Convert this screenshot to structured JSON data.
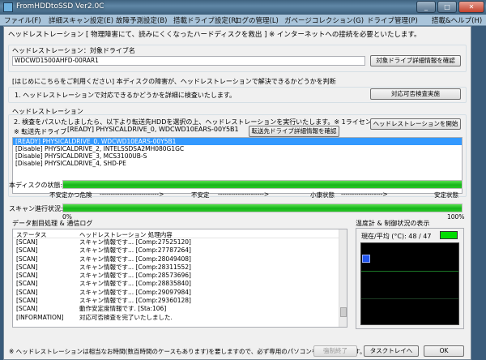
{
  "window": {
    "title": "FromHDDtoSSD Ver2.0C",
    "min": "_",
    "max": "□",
    "close": "✕"
  },
  "menu": [
    "ファイル(F)",
    "詳細スキャン設定(E)",
    "故障予測設定(B)",
    "搭載ドライブ設定(R)",
    "ログの管理(L)",
    "ガベージコレクション(G)",
    "ドライブ管理(P)",
    "搭載&ヘルプ(H)"
  ],
  "dialog": {
    "title": "ヘッドレストレーション [ 物理障害にて、読みにくくなったハードディスクを救出 ] ※ インターネットへの接続を必要といたします。",
    "target_label": "ヘッドレストレーション：対象ドライブ名",
    "target_value": "WDCWD1500AHFD-00RAR1",
    "target_btn": "対象ドライブ詳細情報を確認",
    "intro_text": "[はじめにこちらをご利用ください] 本ディスクの障害が、ヘッドレストレーションで解決できるかどうかを判断",
    "step1_text": "1. ヘッドレストレーションで対応できるかどうかを詳細に検査いたします。",
    "step1_btn": "対応可否検査実施",
    "section_label": "ヘッドレストレーション",
    "step2_text": "2. 検査をパスいたしましたら、以下より転送先HDDを選択の上、ヘッドレストレーションを実行いたします。※ 1ライセンスを消費いたします。",
    "start_btn": "ヘッドレストレーションを開始",
    "dest_label": "※ 転送先ドライブ",
    "dest_value": "[READY] PHYSICALDRIVE_0, WDCWD10EARS-00Y5B1",
    "dest_btn": "転送先ドライブ詳細情報を確認",
    "drives": [
      "[READY] PHYSICALDRIVE_0, WDCWD10EARS-00Y5B1",
      "[Disable] PHYSICALDRIVE_2, INTELSSDSA2MH080G1GC",
      "[Disable] PHYSICALDRIVE_3, MCS3100UB-S",
      "[Disable] PHYSICALDRIVE_4, SHD-PE"
    ],
    "selected_drive": 0,
    "disk_state_label": "本ディスクの状態:",
    "disk_state_fraction": 1.0,
    "scale_labels": [
      "不安定かつ危険",
      "--------------------------->",
      "不安定",
      "--------------------->",
      "小康状態",
      "------------------->",
      "安定状態"
    ],
    "scan_label": "スキャン進行状況:",
    "scan_fraction": 1.0,
    "scan_min": "0%",
    "scan_max": "100%",
    "log_section": "データ割目処理 & 通信ログ",
    "log_headers": [
      "ステータス",
      "ヘッドレストレーション 処理内容"
    ],
    "log_rows": [
      [
        "[SCAN]",
        "スキャン情報です... [Comp:27525120]"
      ],
      [
        "[SCAN]",
        "スキャン情報です... [Comp:27787264]"
      ],
      [
        "[SCAN]",
        "スキャン情報です... [Comp:28049408]"
      ],
      [
        "[SCAN]",
        "スキャン情報です... [Comp:28311552]"
      ],
      [
        "[SCAN]",
        "スキャン情報です... [Comp:28573696]"
      ],
      [
        "[SCAN]",
        "スキャン情報です... [Comp:28835840]"
      ],
      [
        "[SCAN]",
        "スキャン情報です... [Comp:29097984]"
      ],
      [
        "[SCAN]",
        "スキャン情報です... [Comp:29360128]"
      ],
      [
        "[SCAN]",
        "動作安定度情報です. [Sta:106]"
      ],
      [
        "[INFORMATION]",
        "対応可否検査を完了いたしました."
      ]
    ],
    "thermo_section": "温度計 & 制御状況の表示",
    "thermo_label": "現在/平均 (°C): 48 / 47",
    "footer_note": "※ ヘッドレストレーションは相当なお時間(数百時間のケースもあります)を要しますので、必ず専用のパソコンをご用意願います。",
    "cancel_btn": "強制終了",
    "tray_btn": "タスクトレイへ",
    "ok_btn": "OK"
  },
  "colors": {
    "progress_green": "#1cbd1f",
    "selection_blue": "#3399ff",
    "thermo_indicator": "#00dd00",
    "graph_marker": "#2255ee",
    "graph_line": "#1c7a28"
  }
}
